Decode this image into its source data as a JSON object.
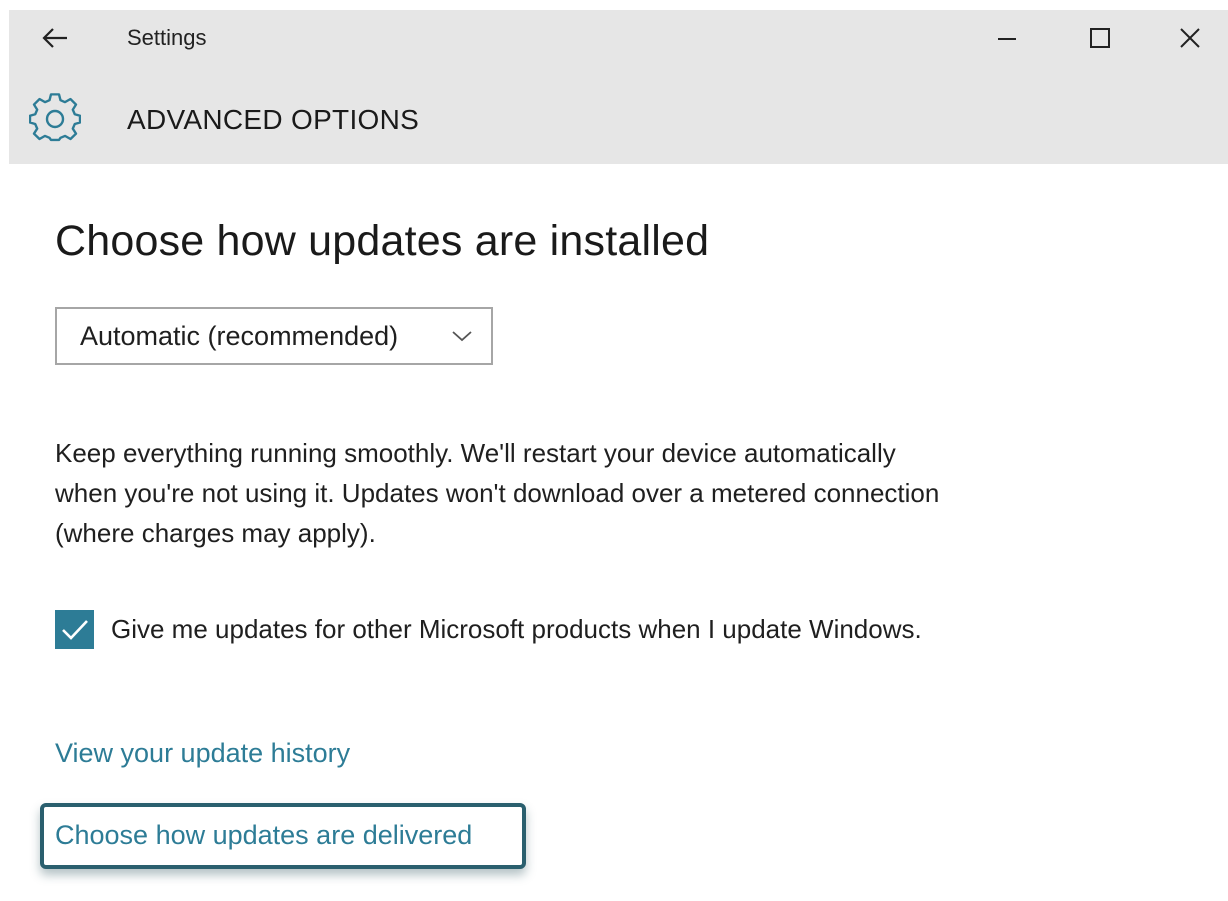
{
  "titlebar": {
    "app_title": "Settings"
  },
  "header": {
    "section_title": "ADVANCED OPTIONS"
  },
  "main": {
    "heading": "Choose how updates are installed",
    "install_mode": {
      "selected": "Automatic (recommended)"
    },
    "description": "Keep everything running smoothly. We'll restart your device automatically when you're not using it. Updates won't download over a metered connection (where charges may apply).",
    "other_products": {
      "checked": true,
      "label": "Give me updates for other Microsoft products when I update Windows."
    },
    "links": {
      "history": "View your update history",
      "delivered": "Choose how updates are delivered"
    }
  },
  "colors": {
    "accent": "#2d7c96",
    "header_bg": "#e6e6e6",
    "focus_border": "#2a5f6e"
  },
  "icons": {
    "back": "back-arrow-icon",
    "minimize": "minimize-icon",
    "maximize": "maximize-icon",
    "close": "close-icon",
    "settings": "gear-icon",
    "dropdown": "chevron-down-icon",
    "check": "checkmark-icon"
  }
}
